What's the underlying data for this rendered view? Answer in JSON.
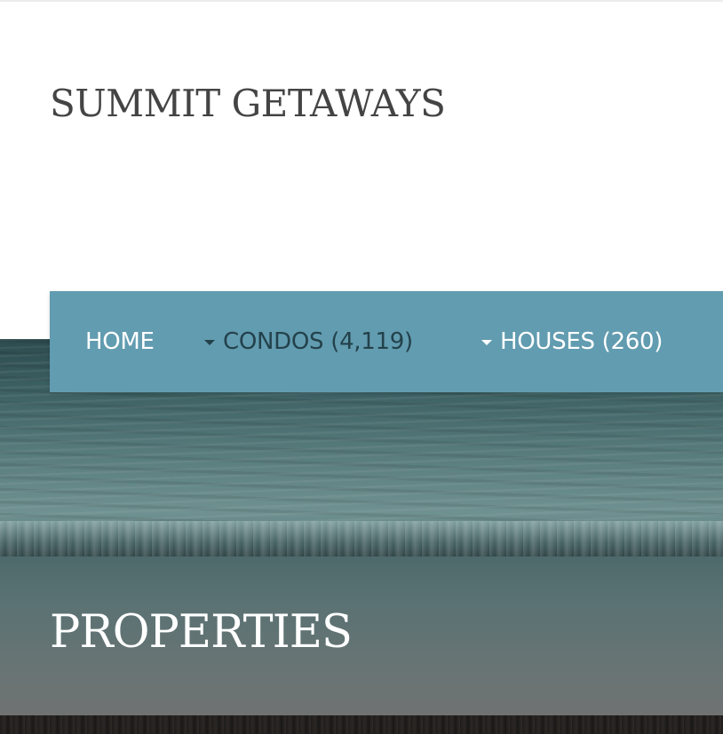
{
  "site": {
    "title": "SUMMIT GETAWAYS"
  },
  "nav": {
    "items": [
      {
        "label": "HOME",
        "has_dropdown": false,
        "active": false
      },
      {
        "label": "CONDOS (4,119)",
        "has_dropdown": true,
        "active": true,
        "icon": "caret-down-icon"
      },
      {
        "label": "HOUSES (260)",
        "has_dropdown": true,
        "active": false,
        "icon": "caret-down-icon"
      }
    ]
  },
  "hero": {
    "heading": "PROPERTIES"
  },
  "colors": {
    "nav_background": "#629cb0",
    "nav_text": "#ffffff",
    "nav_active_text": "#23414b",
    "title_text": "#444444",
    "heading_text": "#ffffff"
  }
}
